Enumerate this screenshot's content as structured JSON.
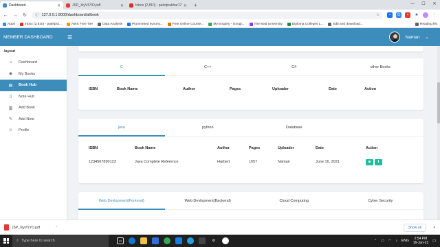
{
  "browser": {
    "tabs": [
      {
        "label": "Dashboard",
        "color": "#3c8dbc",
        "active": true
      },
      {
        "label": "JSP_XiyVSYO.pdf",
        "color": "#e53935",
        "active": false
      },
      {
        "label": "Inbox (2,810) - patelprakhar176...",
        "color": "#d93025",
        "active": false
      }
    ],
    "url": "127.0.0.1:8000/dashboard/allbook",
    "bookmarks": [
      {
        "label": "Apps",
        "color": "#4285f4"
      },
      {
        "label": "Inbox (2,810) - patelpra...",
        "color": "#d93025"
      },
      {
        "label": "AWS Free Tier",
        "color": "#ff9900"
      },
      {
        "label": "Data Analysis",
        "color": "#5f6368"
      },
      {
        "label": "Plummeted synony...",
        "color": "#1a73e8"
      },
      {
        "label": "Free Online Course...",
        "color": "#e37400"
      },
      {
        "label": "My Enquiry - Googl...",
        "color": "#34a853"
      },
      {
        "label": "The Mad University",
        "color": "#9334e6"
      },
      {
        "label": "Diploma Colleges L...",
        "color": "#1e8e3e"
      },
      {
        "label": "Edit and download...",
        "color": "#5f6368"
      }
    ],
    "reading_list": "Reading list"
  },
  "app": {
    "brand": "MEMBER DASHBOARD",
    "user_name": "Naman",
    "sidebar_title": "layout",
    "sidebar_items": [
      {
        "label": "Dashboard",
        "icon": "home-icon",
        "glyph": "⌂"
      },
      {
        "label": "My Books",
        "icon": "user-icon",
        "glyph": "☻"
      },
      {
        "label": "Book Hub",
        "icon": "book-icon",
        "glyph": "▤"
      },
      {
        "label": "Note Hub",
        "icon": "note-icon",
        "glyph": "▯"
      },
      {
        "label": "Add Book",
        "icon": "add-book-icon",
        "glyph": "▥"
      },
      {
        "label": "Add Note",
        "icon": "add-note-icon",
        "glyph": "✎"
      },
      {
        "label": "Profile",
        "icon": "profile-icon",
        "glyph": "☺"
      }
    ],
    "accent": "#3c8dbc"
  },
  "card1": {
    "tabs": [
      "C",
      "C++",
      "C#",
      "other Books"
    ],
    "headers": [
      "ISBN",
      "Book Name",
      "Author",
      "Pages",
      "Uploader",
      "Date",
      "Action"
    ]
  },
  "card2": {
    "tabs": [
      "java",
      "python",
      "Database"
    ],
    "headers": [
      "ISBN",
      "Book Name",
      "Author",
      "Pages",
      "Uploader",
      "Date",
      "Action"
    ],
    "row": {
      "isbn": "1234567890123",
      "book_name": "Java Complete Reference",
      "author": "Harbert",
      "pages": "1057",
      "uploader": "Naman",
      "date": "June 16, 2021"
    }
  },
  "card3": {
    "tabs": [
      "Web Devlopment(Fontend)",
      "Web Devlopment(Backend)",
      "Cloud Computing",
      "Cyber Security"
    ]
  },
  "download": {
    "file": "JSP_XiyVSYO.pdf",
    "show_all": "Show all"
  },
  "taskbar": {
    "search_placeholder": "Type here to search",
    "language": "ENG",
    "time": "2:54 PM",
    "date": "16-Jun-21"
  }
}
